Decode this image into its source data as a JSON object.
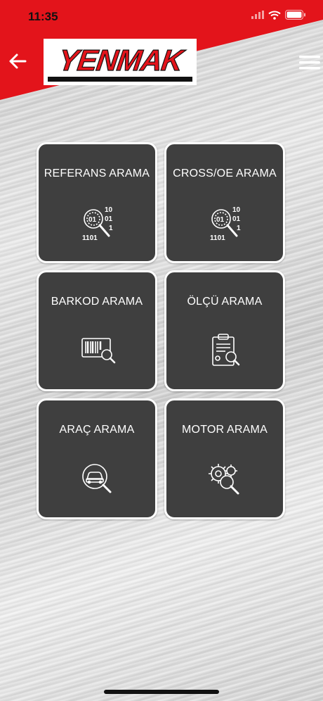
{
  "status_bar": {
    "time": "11:35"
  },
  "header": {
    "logo_text": "YENMAK",
    "brand_color": "#e3141b"
  },
  "tiles": [
    {
      "label": "REFERANS ARAMA",
      "icon": "binary-search-icon"
    },
    {
      "label": "CROSS/OE ARAMA",
      "icon": "binary-search-icon"
    },
    {
      "label": "BARKOD ARAMA",
      "icon": "barcode-search-icon"
    },
    {
      "label": "ÖLÇÜ ARAMA",
      "icon": "clipboard-search-icon"
    },
    {
      "label": "ARAÇ ARAMA",
      "icon": "car-search-icon"
    },
    {
      "label": "MOTOR ARAMA",
      "icon": "engine-gear-search-icon"
    }
  ]
}
